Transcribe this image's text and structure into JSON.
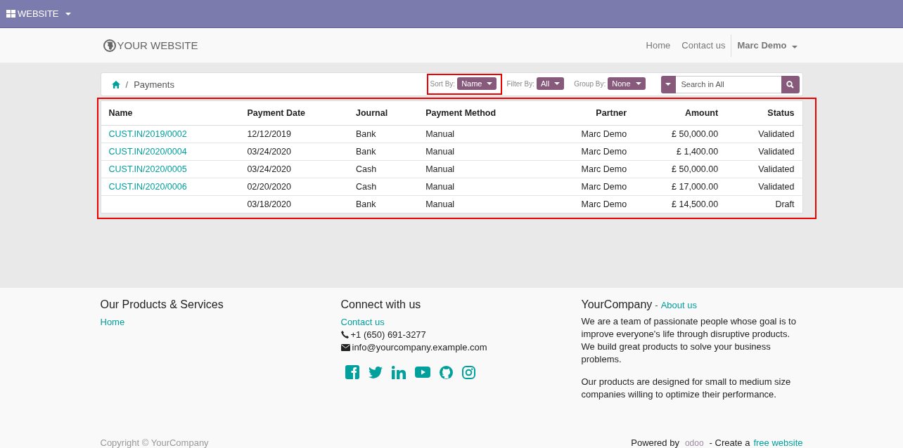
{
  "top_bar": {
    "menu": "WEBSITE"
  },
  "header": {
    "logo": "YOUR WEBSITE",
    "nav": [
      "Home",
      "Contact us"
    ],
    "user": "Marc Demo"
  },
  "breadcrumb": {
    "separator": "/",
    "current": "Payments"
  },
  "controls": [
    {
      "label": "Sort By:",
      "value": "Name",
      "highlighted": true
    },
    {
      "label": "Filter By:",
      "value": "All",
      "highlighted": false
    },
    {
      "label": "Group By:",
      "value": "None",
      "highlighted": false
    }
  ],
  "search": {
    "placeholder": "Search in All"
  },
  "table": {
    "highlighted": true,
    "columns": [
      "Name",
      "Payment Date",
      "Journal",
      "Payment Method",
      "Partner",
      "Amount",
      "Status"
    ],
    "rows": [
      [
        "CUST.IN/2019/0002",
        "12/12/2019",
        "Bank",
        "Manual",
        "Marc Demo",
        "£ 50,000.00",
        "Validated"
      ],
      [
        "CUST.IN/2020/0004",
        "03/24/2020",
        "Bank",
        "Manual",
        "Marc Demo",
        "£ 1,400.00",
        "Validated"
      ],
      [
        "CUST.IN/2020/0005",
        "03/24/2020",
        "Cash",
        "Manual",
        "Marc Demo",
        "£ 50,000.00",
        "Validated"
      ],
      [
        "CUST.IN/2020/0006",
        "02/20/2020",
        "Cash",
        "Manual",
        "Marc Demo",
        "£ 17,000.00",
        "Validated"
      ],
      [
        "",
        "03/18/2020",
        "Bank",
        "Manual",
        "Marc Demo",
        "£ 14,500.00",
        "Draft"
      ]
    ]
  },
  "footer": {
    "products": {
      "title": "Our Products & Services",
      "links": [
        "Home"
      ]
    },
    "connect": {
      "title": "Connect with us",
      "link": "Contact us",
      "phone": "+1 (650) 691-3277",
      "email": "info@yourcompany.example.com"
    },
    "about": {
      "title": "YourCompany",
      "separator": "-",
      "link": "About us",
      "paragraphs": [
        "We are a team of passionate people whose goal is to improve everyone's life through disruptive products. We build great products to solve your business problems.",
        "Our products are designed for small to medium size companies willing to optimize their performance."
      ]
    },
    "copyright": "Copyright © YourCompany",
    "powered": "Powered by",
    "brand": "odoo",
    "create": "- Create a",
    "create_link": "free website"
  }
}
